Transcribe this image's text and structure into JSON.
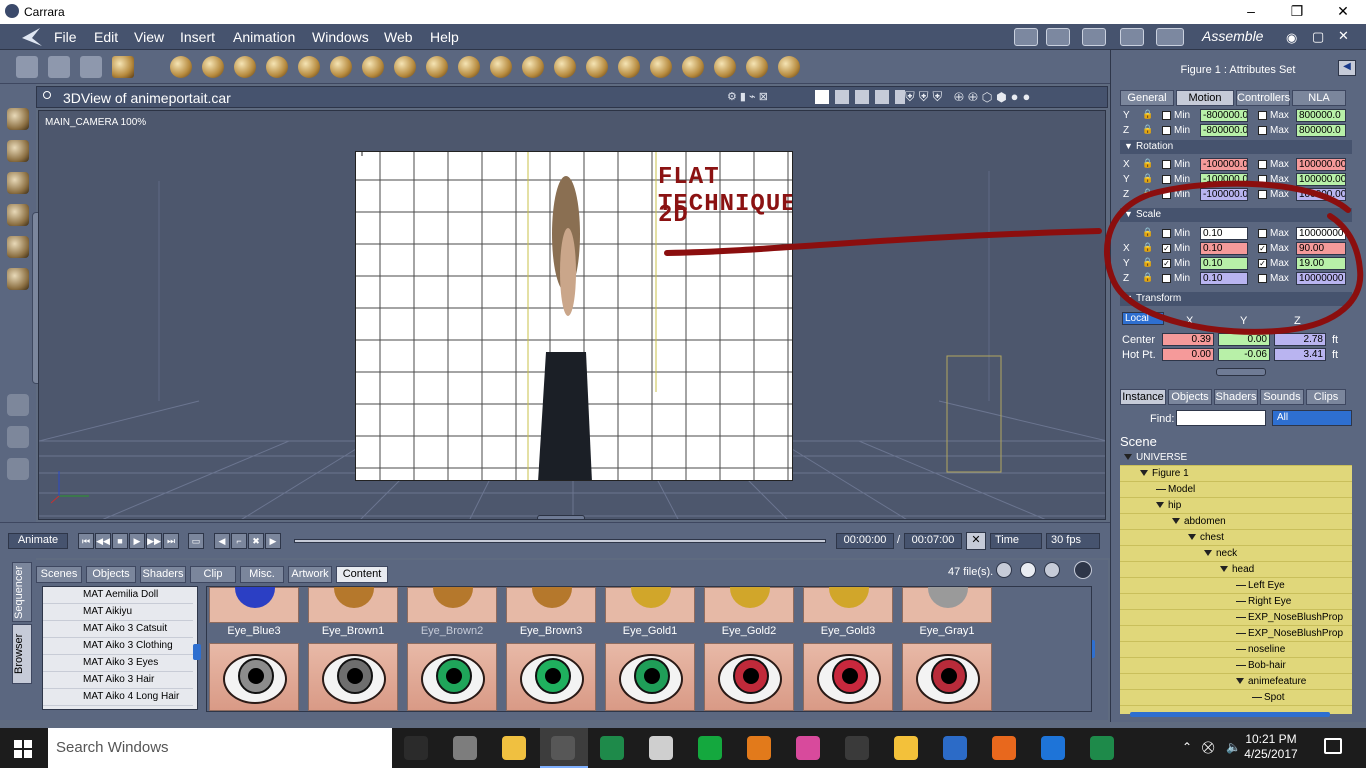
{
  "window": {
    "title": "Carrara",
    "minimize": "–",
    "maximize": "❐",
    "close": "✕"
  },
  "menu": [
    "File",
    "Edit",
    "View",
    "Insert",
    "Animation",
    "Windows",
    "Web",
    "Help"
  ],
  "room": "Assemble",
  "viewport": {
    "title": "3DView of animeportait.car",
    "camera": "MAIN_CAMERA 100%",
    "overlay_line1": "FLAT TECHNIQUE",
    "overlay_line2": "2D"
  },
  "animation": {
    "animate_label": "Animate",
    "current_time": "00:00:00",
    "separator": "/",
    "end_time": "00:07:00",
    "time_mode": "Time",
    "fps": "30 fps"
  },
  "browser": {
    "vtabs": [
      "Sequencer",
      "Browser"
    ],
    "tabs": [
      "Scenes",
      "Objects",
      "Shaders",
      "Clip",
      "Misc.",
      "Artwork",
      "Content"
    ],
    "active_tab": "Content",
    "file_count": "47 file(s).",
    "list": [
      "MAT Aemilia Doll",
      "MAT Aikiyu",
      "MAT Aiko 3 Catsuit",
      "MAT Aiko 3 Clothing",
      "MAT Aiko 3 Eyes",
      "MAT Aiko 3 Hair",
      "MAT Aiko 4 Long Hair"
    ],
    "thumb_row1": [
      {
        "label": "Eye_Blue3",
        "color": "#2b3fc4"
      },
      {
        "label": "Eye_Brown1",
        "color": "#b5782c"
      },
      {
        "label": "Eye_Brown2",
        "color": "#b5782c"
      },
      {
        "label": "Eye_Brown3",
        "color": "#b5782c"
      },
      {
        "label": "Eye_Gold1",
        "color": "#d1a62a"
      },
      {
        "label": "Eye_Gold2",
        "color": "#d1a62a"
      },
      {
        "label": "Eye_Gold3",
        "color": "#d1a62a"
      },
      {
        "label": "Eye_Gray1",
        "color": "#9a9a9a"
      }
    ],
    "thumb_row2_iris_colors": [
      "#8c8c8c",
      "#6e6e6e",
      "#1fa55a",
      "#1fb05e",
      "#1f9e58",
      "#c02a3a",
      "#c8283d",
      "#b82b3a"
    ]
  },
  "attributes": {
    "header": "Figure 1 : Attributes Set",
    "tabs": [
      "General",
      "Motion",
      "Controllers",
      "NLA"
    ],
    "active_tab": "Motion",
    "position_rows": [
      {
        "axis": "Y",
        "min_label": "Min",
        "min": "-800000.0",
        "max_label": "Max",
        "max": "800000.0"
      },
      {
        "axis": "Z",
        "min_label": "Min",
        "min": "-800000.0",
        "max_label": "Max",
        "max": "800000.0"
      }
    ],
    "rotation": {
      "title": "Rotation",
      "rows": [
        {
          "axis": "X",
          "min_label": "Min",
          "min": "-100000.0",
          "max_label": "Max",
          "max": "100000.00"
        },
        {
          "axis": "Y",
          "min_label": "Min",
          "min": "-100000.0",
          "max_label": "Max",
          "max": "100000.00"
        },
        {
          "axis": "Z",
          "min_label": "Min",
          "min": "-100000.0",
          "max_label": "Max",
          "max": "100000.00"
        }
      ]
    },
    "scale": {
      "title": "Scale",
      "rows": [
        {
          "axis": "",
          "min_label": "Min",
          "min": "0.10",
          "max_label": "Max",
          "max": "10000000",
          "min_color": "#ffffff",
          "max_color": "#ffffff",
          "checked": false
        },
        {
          "axis": "X",
          "min_label": "Min",
          "min": "0.10",
          "max_label": "Max",
          "max": "90.00",
          "min_color": "#f59a9a",
          "max_color": "#f59a9a",
          "checked": true
        },
        {
          "axis": "Y",
          "min_label": "Min",
          "min": "0.10",
          "max_label": "Max",
          "max": "19.00",
          "min_color": "#b8f0a8",
          "max_color": "#b8f0a8",
          "checked": true
        },
        {
          "axis": "Z",
          "min_label": "Min",
          "min": "0.10",
          "max_label": "Max",
          "max": "10000000",
          "min_color": "#b9b4f0",
          "max_color": "#b9b4f0",
          "checked": false
        }
      ]
    },
    "transform": {
      "title": "Transform",
      "mode": "Local",
      "cols": [
        "X",
        "Y",
        "Z"
      ],
      "center_label": "Center",
      "center": [
        "0.39",
        "0.00",
        "2.78"
      ],
      "hotpt_label": "Hot Pt.",
      "hotpt": [
        "0.00",
        "-0.06",
        "3.41"
      ],
      "unit": "ft"
    }
  },
  "instance": {
    "tabs": [
      "Instance",
      "Objects",
      "Shaders",
      "Sounds",
      "Clips"
    ],
    "find_label": "Find:",
    "find_value": "",
    "filter": "All",
    "scene_title": "Scene",
    "tree": [
      {
        "label": "UNIVERSE",
        "depth": 0,
        "open": true
      },
      {
        "label": "Figure 1",
        "depth": 1,
        "open": true
      },
      {
        "label": "Model",
        "depth": 2,
        "open": false
      },
      {
        "label": "hip",
        "depth": 2,
        "open": true
      },
      {
        "label": "abdomen",
        "depth": 3,
        "open": true
      },
      {
        "label": "chest",
        "depth": 4,
        "open": true
      },
      {
        "label": "neck",
        "depth": 5,
        "open": true
      },
      {
        "label": "head",
        "depth": 6,
        "open": true
      },
      {
        "label": "Left Eye",
        "depth": 7,
        "open": false
      },
      {
        "label": "Right Eye",
        "depth": 7,
        "open": false
      },
      {
        "label": "EXP_NoseBlushProp",
        "depth": 7,
        "open": false
      },
      {
        "label": "EXP_NoseBlushProp",
        "depth": 7,
        "open": false
      },
      {
        "label": "noseline",
        "depth": 7,
        "open": false
      },
      {
        "label": "Bob-hair",
        "depth": 7,
        "open": false
      },
      {
        "label": "animefeature",
        "depth": 7,
        "open": true
      },
      {
        "label": "Spot",
        "depth": 8,
        "open": false
      }
    ]
  },
  "taskbar": {
    "search_placeholder": "Search Windows",
    "time": "10:21 PM",
    "date": "4/25/2017",
    "app_colors": [
      "#2b2b2b",
      "#7d7d7d",
      "#f0c040",
      "#3a3a3a",
      "#1e8a4a",
      "#cfcfcf",
      "#14a83e",
      "#e27a1b",
      "#d84a9c",
      "#3a3a3a",
      "#f3c13a",
      "#2c6bc7",
      "#e8681d",
      "#1e74d8",
      "#1e8a4a"
    ]
  }
}
